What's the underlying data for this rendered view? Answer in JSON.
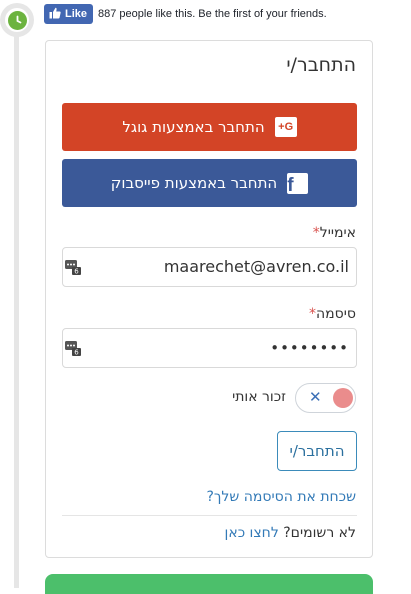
{
  "fb": {
    "like_label": "Like",
    "like_text": "887 people like this. Be the first of your friends."
  },
  "card": {
    "title": "התחבר/י",
    "google_label": "התחבר באמצעות גוגל",
    "google_icon_text": "G+",
    "facebook_label": "התחבר באמצעות פייסבוק",
    "facebook_icon_text": "f",
    "email_label": "אימייל",
    "email_value": "maarechet@avren.co.il",
    "password_label": "סיסמה",
    "password_value": "••••••••",
    "required_mark": "*",
    "password_manager_badge": "6",
    "remember_label": "זכור אותי",
    "toggle_symbol": "✕",
    "submit_label": "התחבר/י",
    "forgot_link": "שכחת את הסיסמה שלך?",
    "register_prompt": "לא רשומים?",
    "register_link": "לחצו כאן"
  },
  "colors": {
    "google": "#d34426",
    "facebook": "#3b5998",
    "timeline_dot": "#6cb33f",
    "toggle_off": "#ea8c8c",
    "link": "#337ab7"
  }
}
